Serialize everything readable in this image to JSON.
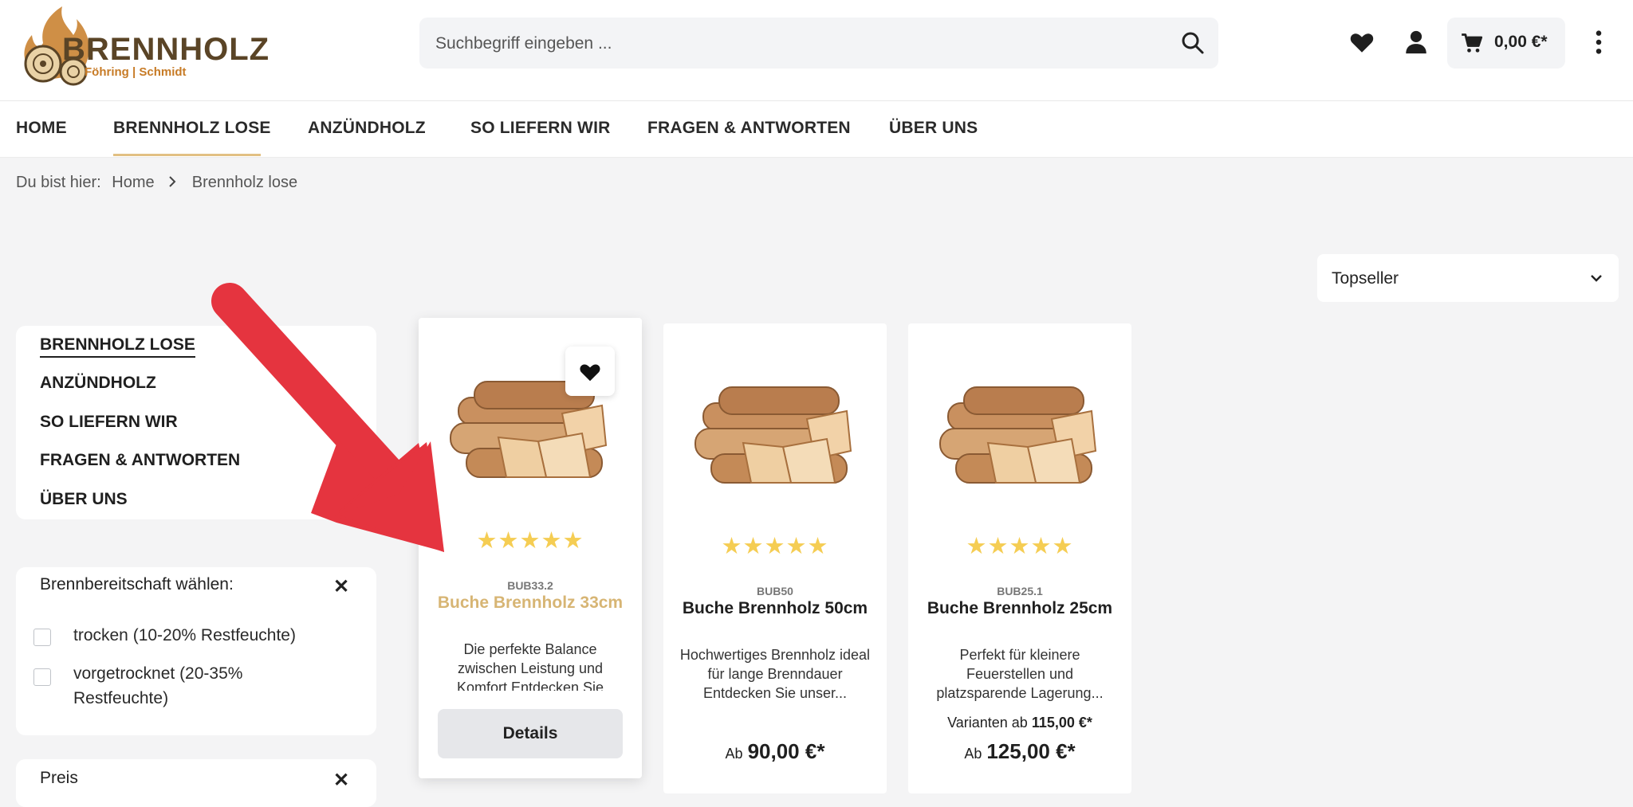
{
  "colors": {
    "accent": "#e2c083",
    "brand_brown": "#5a4426",
    "brand_orange": "#c77b26",
    "star": "#f5cd53",
    "annotation_arrow": "#e5343f"
  },
  "logo": {
    "wordmark": "BRENNHOLZ",
    "subtitle": "Föhring | Schmidt"
  },
  "search": {
    "placeholder": "Suchbegriff eingeben ..."
  },
  "header": {
    "cart_total": "0,00 €*",
    "icons": [
      "heart-icon",
      "user-icon",
      "cart-icon",
      "more-vertical-icon"
    ]
  },
  "nav": [
    {
      "label": "HOME"
    },
    {
      "label": "BRENNHOLZ LOSE",
      "active": true
    },
    {
      "label": "ANZÜNDHOLZ"
    },
    {
      "label": "SO LIEFERN WIR"
    },
    {
      "label": "FRAGEN & ANTWORTEN"
    },
    {
      "label": "ÜBER UNS"
    }
  ],
  "breadcrumb": {
    "prefix": "Du bist hier:",
    "items": [
      "Home",
      "Brennholz lose"
    ]
  },
  "sort": {
    "selected": "Topseller"
  },
  "sidebar": {
    "items": [
      {
        "label": "BRENNHOLZ LOSE",
        "active": true
      },
      {
        "label": "ANZÜNDHOLZ"
      },
      {
        "label": "SO LIEFERN WIR"
      },
      {
        "label": "FRAGEN & ANTWORTEN"
      },
      {
        "label": "ÜBER UNS"
      }
    ]
  },
  "filters": {
    "readiness": {
      "title": "Brennbereitschaft wählen:",
      "options": [
        {
          "label": "trocken (10-20% Restfeuchte)",
          "checked": false
        },
        {
          "label": "vorgetrocknet (20-35% Restfeuchte)",
          "checked": false
        }
      ]
    },
    "price": {
      "title": "Preis"
    }
  },
  "products": [
    {
      "sku": "BUB33.2",
      "name": "Buche Brennholz 33cm",
      "rating": 5,
      "description": "Die perfekte Balance zwischen Leistung und Komfort Entdecken Sie",
      "button": "Details",
      "highlighted": true
    },
    {
      "sku": "BUB50",
      "name": "Buche Brennholz 50cm",
      "rating": 5,
      "description": "Hochwertiges Brennholz ideal für lange Brenndauer Entdecken Sie unser...",
      "price_prefix": "Ab",
      "price": "90,00 €*"
    },
    {
      "sku": "BUB25.1",
      "name": "Buche Brennholz 25cm",
      "rating": 5,
      "description": "Perfekt für kleinere Feuerstellen und platzsparende Lagerung...",
      "variant_prefix": "Varianten ab",
      "variant_price": "115,00 €*",
      "price_prefix": "Ab",
      "price": "125,00 €*"
    }
  ],
  "stars": "★★★★★"
}
